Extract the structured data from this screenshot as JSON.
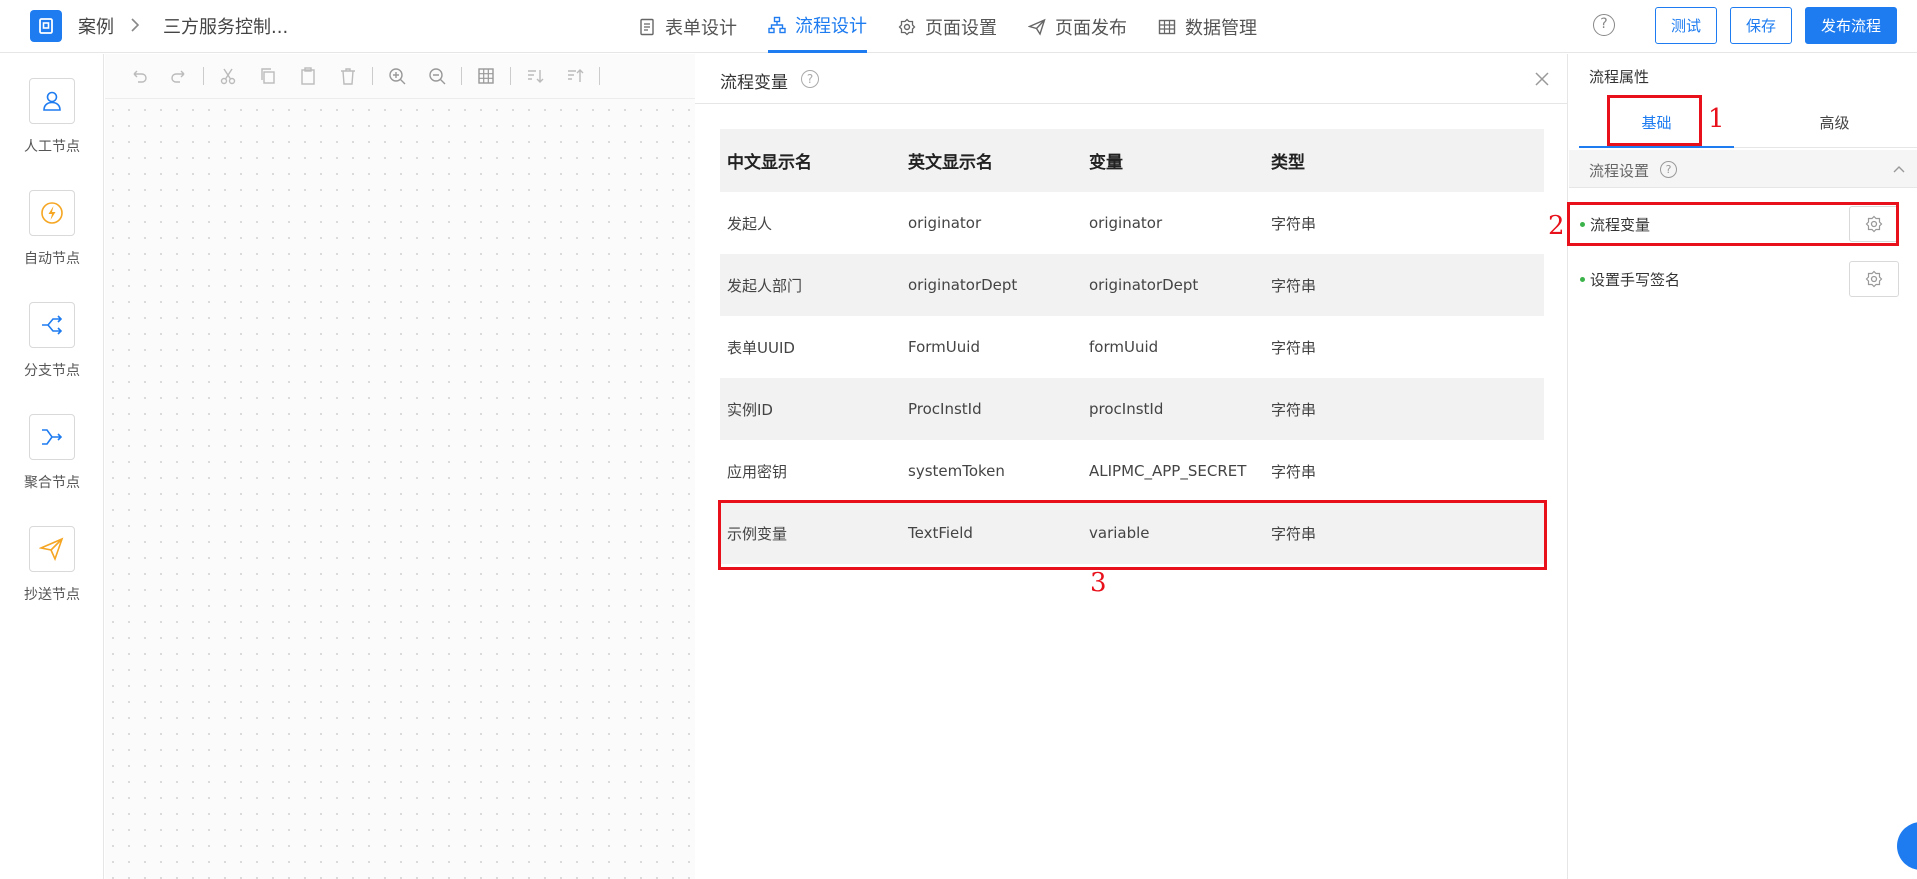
{
  "header": {
    "breadcrumb": [
      "案例",
      "三方服务控制..."
    ],
    "nav": [
      "表单设计",
      "流程设计",
      "页面设置",
      "页面发布",
      "数据管理"
    ],
    "active_nav": "流程设计",
    "help": "?",
    "buttons": {
      "test": "测试",
      "save": "保存",
      "publish": "发布流程"
    }
  },
  "palette": {
    "nodes": [
      {
        "label": "人工节点",
        "icon": "person-icon"
      },
      {
        "label": "自动节点",
        "icon": "lightning-icon"
      },
      {
        "label": "分支节点",
        "icon": "branch-icon"
      },
      {
        "label": "聚合节点",
        "icon": "merge-icon"
      },
      {
        "label": "抄送节点",
        "icon": "send-icon"
      }
    ]
  },
  "variables_panel": {
    "title": "流程变量",
    "help": "?",
    "columns": [
      "中文显示名",
      "英文显示名",
      "变量",
      "类型"
    ],
    "rows": [
      [
        "发起人",
        "originator",
        "originator",
        "字符串"
      ],
      [
        "发起人部门",
        "originatorDept",
        "originatorDept",
        "字符串"
      ],
      [
        "表单UUID",
        "FormUuid",
        "formUuid",
        "字符串"
      ],
      [
        "实例ID",
        "ProcInstId",
        "procInstId",
        "字符串"
      ],
      [
        "应用密钥",
        "systemToken",
        "ALIPMC_APP_SECRET",
        "字符串"
      ],
      [
        "示例变量",
        "TextField",
        "variable",
        "字符串"
      ]
    ]
  },
  "properties": {
    "title": "流程属性",
    "tabs": [
      "基础",
      "高级"
    ],
    "active_tab": "基础",
    "section": "流程设置",
    "section_help": "?",
    "items": [
      "流程变量",
      "设置手写签名"
    ]
  },
  "annotations": [
    "1",
    "2",
    "3"
  ],
  "colors": {
    "accent": "#1e7cf0",
    "highlight": "#e8101a",
    "status_dot": "#3bb34a"
  }
}
